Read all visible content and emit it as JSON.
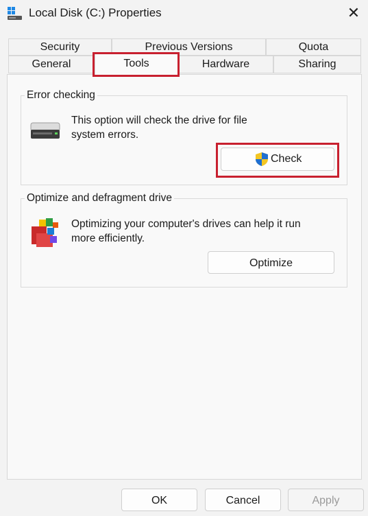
{
  "window": {
    "title": "Local Disk (C:) Properties",
    "close_glyph": "✕",
    "app_icon": "drive-properties-icon"
  },
  "tabs": {
    "back_row": [
      "Security",
      "Previous Versions",
      "Quota"
    ],
    "front_row": [
      "General",
      "Tools",
      "Hardware",
      "Sharing"
    ],
    "active": "Tools"
  },
  "error_checking": {
    "group_label": "Error checking",
    "description_line1": "This option will check the drive for file",
    "description_line2": "system errors.",
    "button_label": "Check",
    "icon": "hard-drive-icon",
    "button_icon": "uac-shield-icon"
  },
  "optimize": {
    "group_label": "Optimize and defragment drive",
    "description_line1": "Optimizing your computer's drives can help it run",
    "description_line2": "more efficiently.",
    "button_label": "Optimize",
    "icon": "defragment-icon"
  },
  "footer": {
    "ok_label": "OK",
    "cancel_label": "Cancel",
    "apply_label": "Apply",
    "apply_enabled": false
  },
  "colors": {
    "highlight": "#c8202f",
    "background": "#f3f3f3",
    "panel": "#f9f9f9"
  }
}
